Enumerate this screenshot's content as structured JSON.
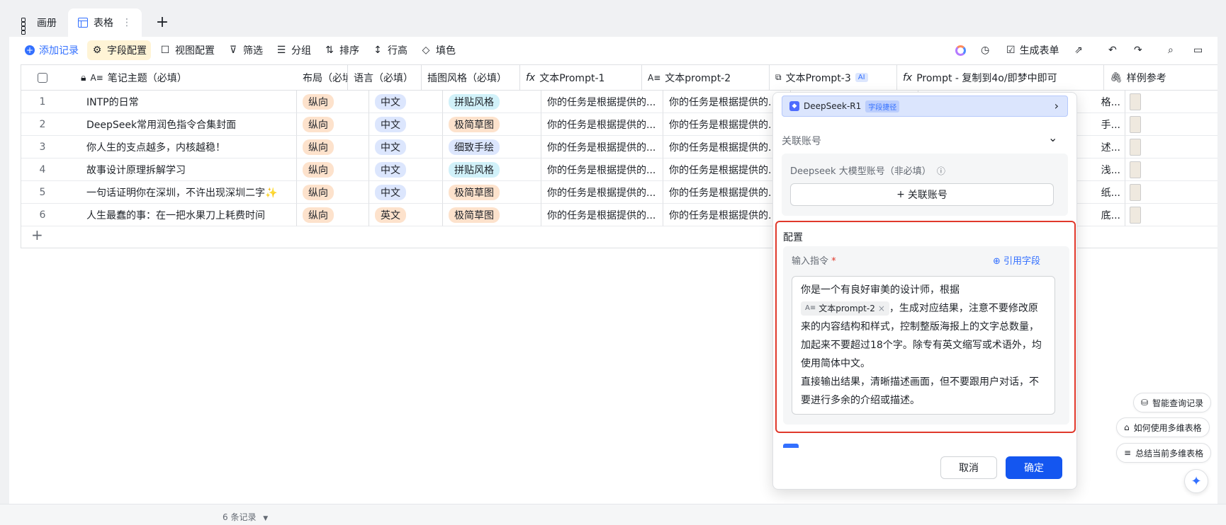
{
  "tabs": [
    {
      "label": "画册",
      "icon": "grid-icon"
    },
    {
      "label": "表格",
      "icon": "table-icon"
    }
  ],
  "toolbar": {
    "add_record": "添加记录",
    "field_config": "字段配置",
    "view_config": "视图配置",
    "filter": "筛选",
    "group": "分组",
    "sort": "排序",
    "row_height": "行高",
    "fill_color": "填色",
    "generate_form": "生成表单"
  },
  "columns": [
    "笔记主题（必填）",
    "布局（必填）",
    "语言（必填）",
    "插图风格（必填）",
    "文本Prompt-1",
    "文本prompt-2",
    "文本Prompt-3",
    "Prompt - 复制到4o/即梦中即可",
    "样例参考"
  ],
  "ai_badge": "AI",
  "rows": [
    {
      "num": "1",
      "title": "INTP的日常",
      "layout": "纵向",
      "lang": "中文",
      "style": "拼贴风格",
      "style_color": "cyan",
      "p1": "你的任务是根据提供的...",
      "p2": "你的任务是根据提供的...",
      "p4": "格..."
    },
    {
      "num": "2",
      "title": "DeepSeek常用润色指令合集封面",
      "layout": "纵向",
      "lang": "中文",
      "style": "极简草图",
      "style_color": "orange",
      "p1": "你的任务是根据提供的...",
      "p2": "你的任务是根据提供的...",
      "p4": "手..."
    },
    {
      "num": "3",
      "title": "你人生的支点越多，内核越稳！",
      "layout": "纵向",
      "lang": "中文",
      "style": "细致手绘",
      "style_color": "blue",
      "p1": "你的任务是根据提供的...",
      "p2": "你的任务是根据提供的...",
      "p4": "述..."
    },
    {
      "num": "4",
      "title": "故事设计原理拆解学习",
      "layout": "纵向",
      "lang": "中文",
      "style": "拼贴风格",
      "style_color": "cyan",
      "p1": "你的任务是根据提供的...",
      "p2": "你的任务是根据提供的...",
      "p4": "浅..."
    },
    {
      "num": "5",
      "title": "一句话证明你在深圳，不许出现深圳二字✨",
      "layout": "纵向",
      "lang": "中文",
      "style": "极简草图",
      "style_color": "orange",
      "p1": "你的任务是根据提供的...",
      "p2": "你的任务是根据提供的...",
      "p4": "纸..."
    },
    {
      "num": "6",
      "title": "人生最蠢的事：在一把水果刀上耗费时间",
      "layout": "纵向",
      "lang": "英文",
      "style": "极简草图",
      "style_color": "orange",
      "p1": "你的任务是根据提供的...",
      "p2": "你的任务是根据提供的...",
      "p4": "底..."
    }
  ],
  "panel": {
    "model_name": "DeepSeek-R1",
    "model_tag": "字段捷径",
    "linked_account_title": "关联账号",
    "account_label": "Deepseek 大模型账号（非必填）",
    "link_account_button": "关联账号",
    "config_title": "配置",
    "input_label": "输入指令",
    "required_mark": "*",
    "ref_field": "引用字段",
    "prompt_line1": "你是一个有良好审美的设计师，根据",
    "chip_label": "文本prompt-2",
    "prompt_line2": "，生成对应结果，注意不要修改原来的内容结构和样式，控制整版海报上的文字总数量，加起来不要超过18个字。除专有英文缩写或术语外，均使用简体中文。",
    "prompt_line3": "直接输出结果，清晰描述画面，但不要跟用户对话，不要进行多余的介绍或描述。",
    "cancel": "取消",
    "confirm": "确定"
  },
  "side_actions": [
    "智能查询记录",
    "如何使用多维表格",
    "总结当前多维表格"
  ],
  "footer": {
    "records": "6 条记录"
  }
}
